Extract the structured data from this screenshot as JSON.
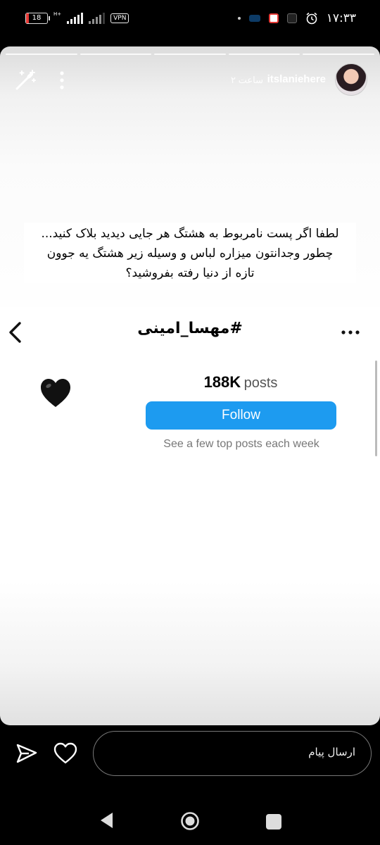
{
  "status_bar": {
    "battery": "18",
    "network": "H+",
    "vpn": "VPN",
    "time": "۱۷:۳۳"
  },
  "story": {
    "username": "itslaniehere",
    "time_ago": "۲ ساعت",
    "note_lines": [
      "لطفا اگر پست نامربوط به هشتگ هر جایی دیدید بلاک کنید...",
      "چطور وجدانتون میزاره لباس و وسیله زیر هشتگ یه جوون",
      "تازه از دنیا رفته بفروشید؟"
    ]
  },
  "hashtag_page": {
    "title": "#مهسا_امینی",
    "emoji": "🖤",
    "post_count": "188K",
    "posts_word": "posts",
    "follow_label": "Follow",
    "subtext": "See a few top posts each week"
  },
  "reply_bar": {
    "placeholder": "ارسال پیام"
  },
  "icons": {
    "magic": "magic-wand-icon",
    "more_vertical": "more-vertical-icon",
    "back": "chevron-left-icon",
    "more_horizontal": "more-horizontal-icon",
    "send": "send-icon",
    "like": "heart-icon"
  },
  "colors": {
    "follow_blue": "#1d9bf0"
  }
}
